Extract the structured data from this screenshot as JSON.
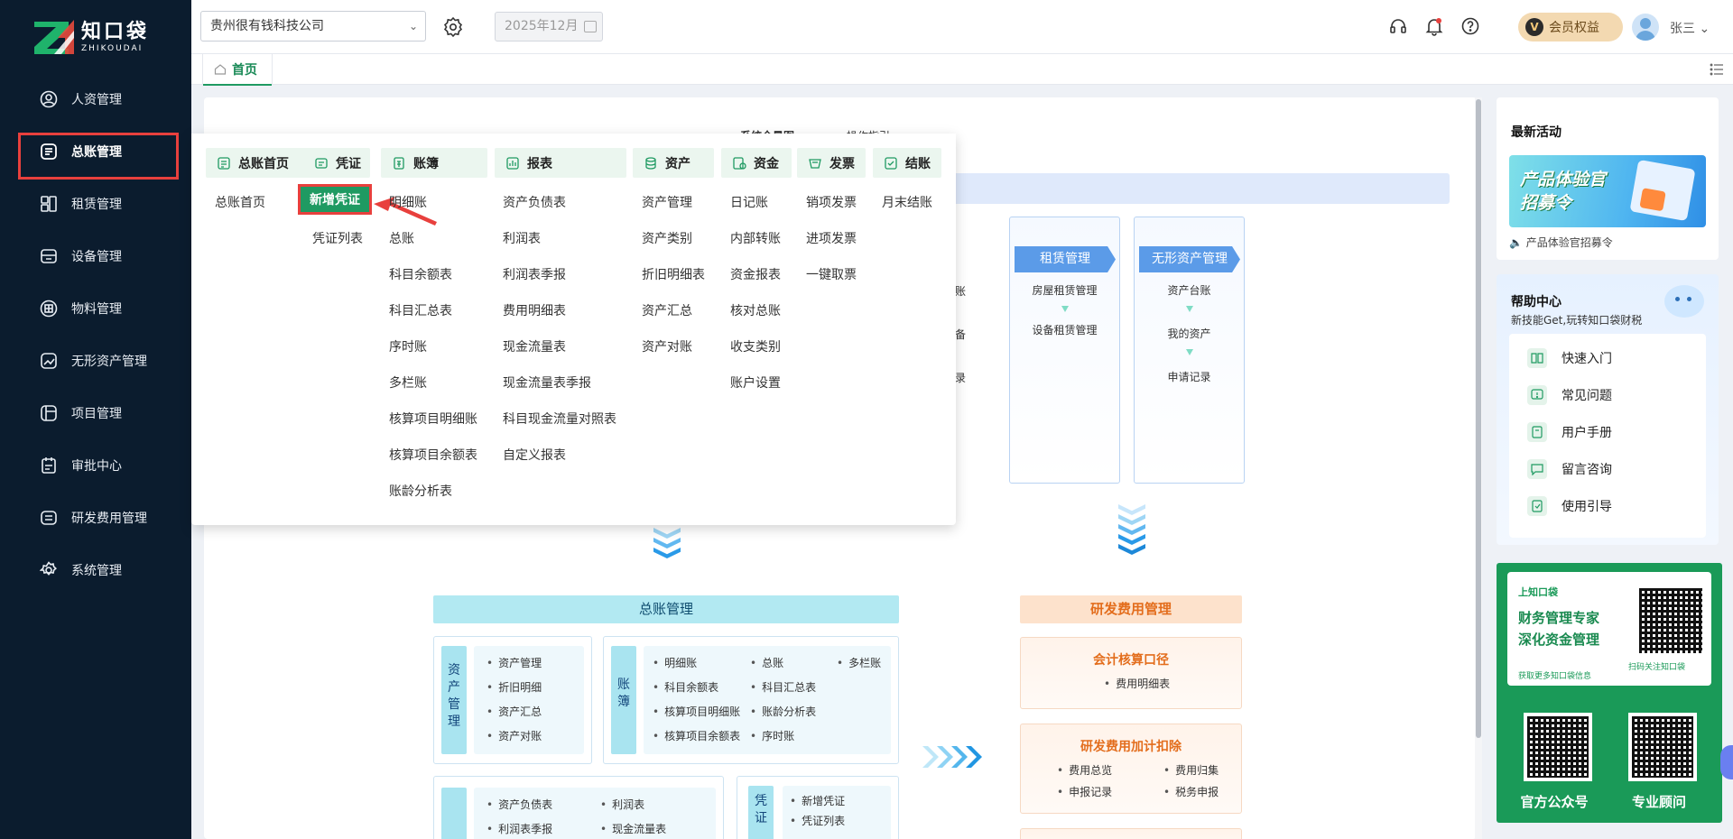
{
  "brand": {
    "name_cn": "知口袋",
    "name_en": "ZHIKOUDAI"
  },
  "sidebar": {
    "items": [
      {
        "label": "人资管理",
        "icon": "user-badge-icon"
      },
      {
        "label": "总账管理",
        "icon": "ledger-icon",
        "active": true
      },
      {
        "label": "租赁管理",
        "icon": "lease-icon"
      },
      {
        "label": "设备管理",
        "icon": "device-icon"
      },
      {
        "label": "物料管理",
        "icon": "material-icon"
      },
      {
        "label": "无形资产管理",
        "icon": "intangible-asset-icon"
      },
      {
        "label": "项目管理",
        "icon": "project-icon"
      },
      {
        "label": "审批中心",
        "icon": "approval-icon"
      },
      {
        "label": "研发费用管理",
        "icon": "rd-expense-icon"
      },
      {
        "label": "系统管理",
        "icon": "settings-icon"
      }
    ]
  },
  "header": {
    "company": "贵州很有钱科技公司",
    "period": "2025年12月",
    "vip_label": "会员权益",
    "vip_badge": "V",
    "user_name": "张三"
  },
  "tabs": {
    "home": "首页"
  },
  "mega_menu": {
    "columns": [
      {
        "category": "总账首页",
        "icon": "home-doc-icon",
        "items": [
          "总账首页"
        ]
      },
      {
        "category": "凭证",
        "icon": "voucher-icon",
        "items": [
          "新增凭证",
          "凭证列表"
        ],
        "highlighted": "新增凭证"
      },
      {
        "category": "账簿",
        "icon": "book-icon",
        "items": [
          "明细账",
          "总账",
          "科目余额表",
          "科目汇总表",
          "序时账",
          "多栏账",
          "核算项目明细账",
          "核算项目余额表",
          "账龄分析表"
        ]
      },
      {
        "category": "报表",
        "icon": "report-icon",
        "items": [
          "资产负债表",
          "利润表",
          "利润表季报",
          "费用明细表",
          "现金流量表",
          "现金流量表季报",
          "科目现金流量对照表",
          "自定义报表"
        ]
      },
      {
        "category": "资产",
        "icon": "asset-icon",
        "items": [
          "资产管理",
          "资产类别",
          "折旧明细表",
          "资产汇总",
          "资产对账"
        ]
      },
      {
        "category": "资金",
        "icon": "fund-icon",
        "items": [
          "日记账",
          "内部转账",
          "资金报表",
          "核对总账",
          "收支类别",
          "账户设置"
        ]
      },
      {
        "category": "发票",
        "icon": "invoice-icon",
        "items": [
          "销项发票",
          "进项发票",
          "一键取票"
        ]
      },
      {
        "category": "结账",
        "icon": "close-account-icon",
        "items": [
          "月末结账"
        ]
      }
    ]
  },
  "dashboard": {
    "header_fragments": [
      "系统全景图",
      "操作指引"
    ],
    "left_fragments": [
      "账",
      "备",
      "录"
    ],
    "lease_module": {
      "title": "租赁管理",
      "items": [
        "房屋租赁管理",
        "设备租赁管理"
      ]
    },
    "intangible_module": {
      "title": "无形资产管理",
      "items": [
        "资产台账",
        "我的资产",
        "申请记录"
      ]
    },
    "ledger_section": {
      "title": "总账管理",
      "asset_label": "资产管理",
      "asset_items": [
        "资产管理",
        "折旧明细",
        "资产汇总",
        "资产对账"
      ],
      "book_label": "账簿",
      "book_items": [
        "明细账",
        "总账",
        "多栏账",
        "科目余额表",
        "科目汇总表",
        "核算项目明细账",
        "账龄分析表",
        "核算项目余额表",
        "序时账"
      ],
      "report_items": [
        "资产负债表",
        "利润表",
        "利润表季报",
        "现金流量表"
      ],
      "voucher_label": "凭证",
      "voucher_items": [
        "新增凭证",
        "凭证列表"
      ]
    },
    "rd_section": {
      "title": "研发费用管理",
      "box1_title": "会计核算口径",
      "box1_items": [
        "费用明细表"
      ],
      "box2_title": "研发费用加计扣除",
      "box2_items": [
        "费用总览",
        "费用归集",
        "申报记录",
        "税务申报"
      ]
    }
  },
  "right_panel": {
    "activity_title": "最新活动",
    "banner_text": [
      "产品体验官",
      "招募令"
    ],
    "activity_item": "产品体验官招募令",
    "help_title": "帮助中心",
    "help_subtitle": "新技能Get,玩转知口袋财税",
    "help_items": [
      "快速入门",
      "常见问题",
      "用户手册",
      "留言咨询",
      "使用引导"
    ],
    "wechat": {
      "small": "上知口袋",
      "line1": "财务管理专家",
      "line2": "深化资金管理",
      "note": "获取更多知口袋信息",
      "scan": "扫码关注知口袋"
    },
    "qr_labels": [
      "官方公众号",
      "专业顾问"
    ]
  },
  "colors": {
    "sidebar_bg": "#0b1c2e",
    "accent_green": "#1f9a62",
    "highlight_red": "#e8403d",
    "module_blue": "#5b9be8"
  }
}
